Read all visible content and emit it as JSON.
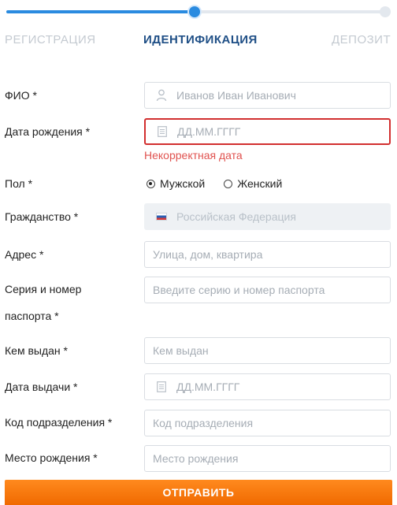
{
  "steps": {
    "labels": [
      "РЕГИСТРАЦИЯ",
      "ИДЕНТИФИКАЦИЯ",
      "ДЕПОЗИТ"
    ],
    "progress": 0.5
  },
  "form": {
    "fio": {
      "label": "ФИО *",
      "placeholder": "Иванов Иван Иванович",
      "icon": "person-icon"
    },
    "birth_date": {
      "label": "Дата рождения *",
      "placeholder": "ДД.ММ.ГГГГ",
      "icon": "calendar-icon",
      "error": "Некорректная дата"
    },
    "gender": {
      "label": "Пол *",
      "options": [
        "Мужской",
        "Женский"
      ],
      "selected": "Мужской"
    },
    "citizenship": {
      "label": "Гражданство *",
      "value": "Российская Федерация",
      "icon": "russia-flag-icon"
    },
    "address": {
      "label": "Адрес *",
      "placeholder": "Улица, дом, квартира"
    },
    "passport": {
      "label_line1": "Серия и номер",
      "label_line2": "паспорта *",
      "placeholder": "Введите серию и номер паспорта"
    },
    "issued_by": {
      "label": "Кем выдан *",
      "placeholder": "Кем выдан"
    },
    "issue_date": {
      "label": "Дата выдачи *",
      "placeholder": "ДД.ММ.ГГГГ",
      "icon": "calendar-icon"
    },
    "division_code": {
      "label": "Код подразделения *",
      "placeholder": "Код подразделения"
    },
    "birth_place": {
      "label": "Место рождения *",
      "placeholder": "Место рождения"
    }
  },
  "submit_label": "ОТПРАВИТЬ",
  "colors": {
    "accent": "#2a8be0",
    "active_tab": "#1f4f86",
    "error": "#d22f2f",
    "submit": "#f47a10"
  }
}
